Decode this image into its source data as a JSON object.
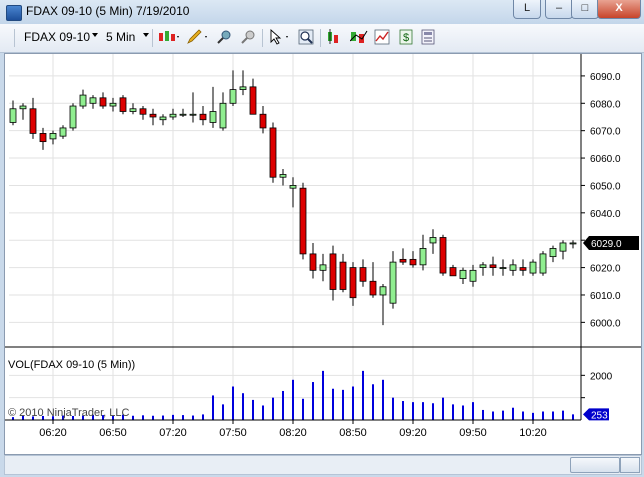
{
  "window": {
    "title": "FDAX 09-10 (5 Min)  7/19/2010",
    "btn_min": "–",
    "btn_max": "□",
    "btn_close": "X",
    "btn_link": "L"
  },
  "toolbar": {
    "instrument": "FDAX 09-10",
    "interval": "5 Min",
    "icons": [
      "bar-type-icon",
      "pencil-icon",
      "crosshair-icon",
      "pin-icon",
      "pointer-icon",
      "zoom-icon",
      "strategy-icon",
      "indicator-icon",
      "chart-trader-icon",
      "dollar-icon",
      "properties-icon"
    ]
  },
  "colors": {
    "up": "#90ee90",
    "down": "#dd0000",
    "wick": "#000000",
    "volume": "#0000dd",
    "price_marker": "#000000",
    "volume_marker": "#0000cc"
  },
  "chart_data": [
    {
      "type": "candlestick",
      "title": "",
      "xlabel": "",
      "ylabel": "",
      "ylim": [
        5991,
        6098
      ],
      "yticks": [
        6000.0,
        6010.0,
        6020.0,
        6030.0,
        6040.0,
        6050.0,
        6060.0,
        6070.0,
        6080.0,
        6090.0
      ],
      "ytick_labels": [
        "6000.0",
        "6010.0",
        "6020.0",
        "6030.0",
        "6040.0",
        "6050.0",
        "6060.0",
        "6070.0",
        "6080.0",
        "6090.0"
      ],
      "last_price_label": "6029.0",
      "last_price": 6029.0,
      "xtick_labels": [
        "06:20",
        "06:50",
        "07:20",
        "07:50",
        "08:20",
        "08:50",
        "09:20",
        "09:50",
        "10:20"
      ],
      "xtick_bar_index": [
        4,
        10,
        16,
        22,
        28,
        34,
        40,
        46,
        52
      ],
      "ohlc": [
        [
          6073,
          6081,
          6072,
          6078
        ],
        [
          6078,
          6080,
          6074,
          6079
        ],
        [
          6078,
          6082,
          6067,
          6069
        ],
        [
          6069,
          6071,
          6063,
          6066
        ],
        [
          6067,
          6070,
          6065,
          6069
        ],
        [
          6068,
          6072,
          6067,
          6071
        ],
        [
          6071,
          6080,
          6070,
          6079
        ],
        [
          6079,
          6085,
          6078,
          6083
        ],
        [
          6080,
          6083,
          6078,
          6082
        ],
        [
          6082,
          6084,
          6078,
          6079
        ],
        [
          6079,
          6082,
          6077,
          6080
        ],
        [
          6082,
          6083,
          6076,
          6077
        ],
        [
          6077,
          6080,
          6076,
          6078
        ],
        [
          6078,
          6079,
          6074,
          6076
        ],
        [
          6076,
          6078,
          6072,
          6075
        ],
        [
          6074,
          6076,
          6072,
          6075
        ],
        [
          6075,
          6078,
          6074,
          6076
        ],
        [
          6076,
          6078,
          6075,
          6076
        ],
        [
          6076,
          6084,
          6073,
          6076
        ],
        [
          6076,
          6079,
          6072,
          6074
        ],
        [
          6073,
          6086,
          6071,
          6077
        ],
        [
          6071,
          6084,
          6070,
          6080
        ],
        [
          6080,
          6092,
          6079,
          6085
        ],
        [
          6085,
          6092,
          6083,
          6086
        ],
        [
          6086,
          6089,
          6076,
          6076
        ],
        [
          6076,
          6079,
          6069,
          6071
        ],
        [
          6071,
          6073,
          6051,
          6053
        ],
        [
          6053,
          6056,
          6050,
          6054
        ],
        [
          6049,
          6053,
          6042,
          6050
        ],
        [
          6049,
          6051,
          6023,
          6025
        ],
        [
          6025,
          6029,
          6016,
          6019
        ],
        [
          6019,
          6025,
          6015,
          6021
        ],
        [
          6025,
          6028,
          6008,
          6012
        ],
        [
          6022,
          6025,
          6011,
          6012
        ],
        [
          6020,
          6022,
          6006,
          6009
        ],
        [
          6020,
          6023,
          6013,
          6015
        ],
        [
          6015,
          6022,
          6009,
          6010
        ],
        [
          6010,
          6014,
          5999,
          6013
        ],
        [
          6007,
          6026,
          6005,
          6022
        ],
        [
          6023,
          6027,
          6021,
          6022
        ],
        [
          6023,
          6026,
          6020,
          6021
        ],
        [
          6021,
          6032,
          6019,
          6027
        ],
        [
          6029,
          6034,
          6025,
          6031
        ],
        [
          6031,
          6032,
          6017,
          6018
        ],
        [
          6020,
          6021,
          6017,
          6017
        ],
        [
          6016,
          6020,
          6014,
          6019
        ],
        [
          6015,
          6021,
          6013,
          6019
        ],
        [
          6020,
          6022,
          6017,
          6021
        ],
        [
          6021,
          6024,
          6017,
          6020
        ],
        [
          6020,
          6023,
          6017,
          6020
        ],
        [
          6019,
          6023,
          6017,
          6021
        ],
        [
          6020,
          6023,
          6017,
          6019
        ],
        [
          6018,
          6023,
          6017,
          6022
        ],
        [
          6018,
          6026,
          6017,
          6025
        ],
        [
          6024,
          6028,
          6022,
          6027
        ],
        [
          6026,
          6030,
          6023,
          6029
        ],
        [
          6029,
          6030,
          6027,
          6029
        ]
      ]
    },
    {
      "type": "bar",
      "title": "VOL(FDAX 09-10 (5 Min))",
      "xlabel": "",
      "ylabel": "",
      "ylim": [
        0,
        3000
      ],
      "yticks": [
        1000,
        2000
      ],
      "ytick_labels": [
        "",
        "2000"
      ],
      "last_value_label": "253",
      "last_value": 253,
      "values": [
        130,
        190,
        160,
        180,
        170,
        200,
        180,
        200,
        230,
        220,
        200,
        240,
        190,
        210,
        190,
        200,
        230,
        220,
        200,
        250,
        1100,
        700,
        1500,
        1200,
        900,
        650,
        1000,
        1300,
        1800,
        950,
        1700,
        2200,
        1400,
        1350,
        1500,
        2200,
        1600,
        1800,
        1000,
        850,
        800,
        800,
        750,
        1000,
        700,
        650,
        800,
        450,
        380,
        420,
        550,
        380,
        320,
        380,
        380,
        420,
        253
      ]
    }
  ],
  "watermark": "© 2010 NinjaTrader, LLC"
}
